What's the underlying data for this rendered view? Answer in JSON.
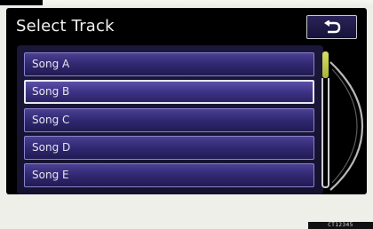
{
  "header": {
    "title": "Select Track",
    "back_icon": "return-arrow-icon"
  },
  "tracks": [
    {
      "label": "Song A",
      "selected": false
    },
    {
      "label": "Song B",
      "selected": true
    },
    {
      "label": "Song C",
      "selected": false
    },
    {
      "label": "Song D",
      "selected": false
    },
    {
      "label": "Song E",
      "selected": false
    }
  ],
  "scrollbar": {
    "icon": "scroll-indicator",
    "position": 0.0
  },
  "footer": {
    "code": "CT12345"
  },
  "colors": {
    "screen_bg": "#000000",
    "item_fill": "#322a74",
    "item_border": "#8a83cf",
    "selected_border": "#e8e8f0",
    "scroll_knob": "#d6df64"
  }
}
